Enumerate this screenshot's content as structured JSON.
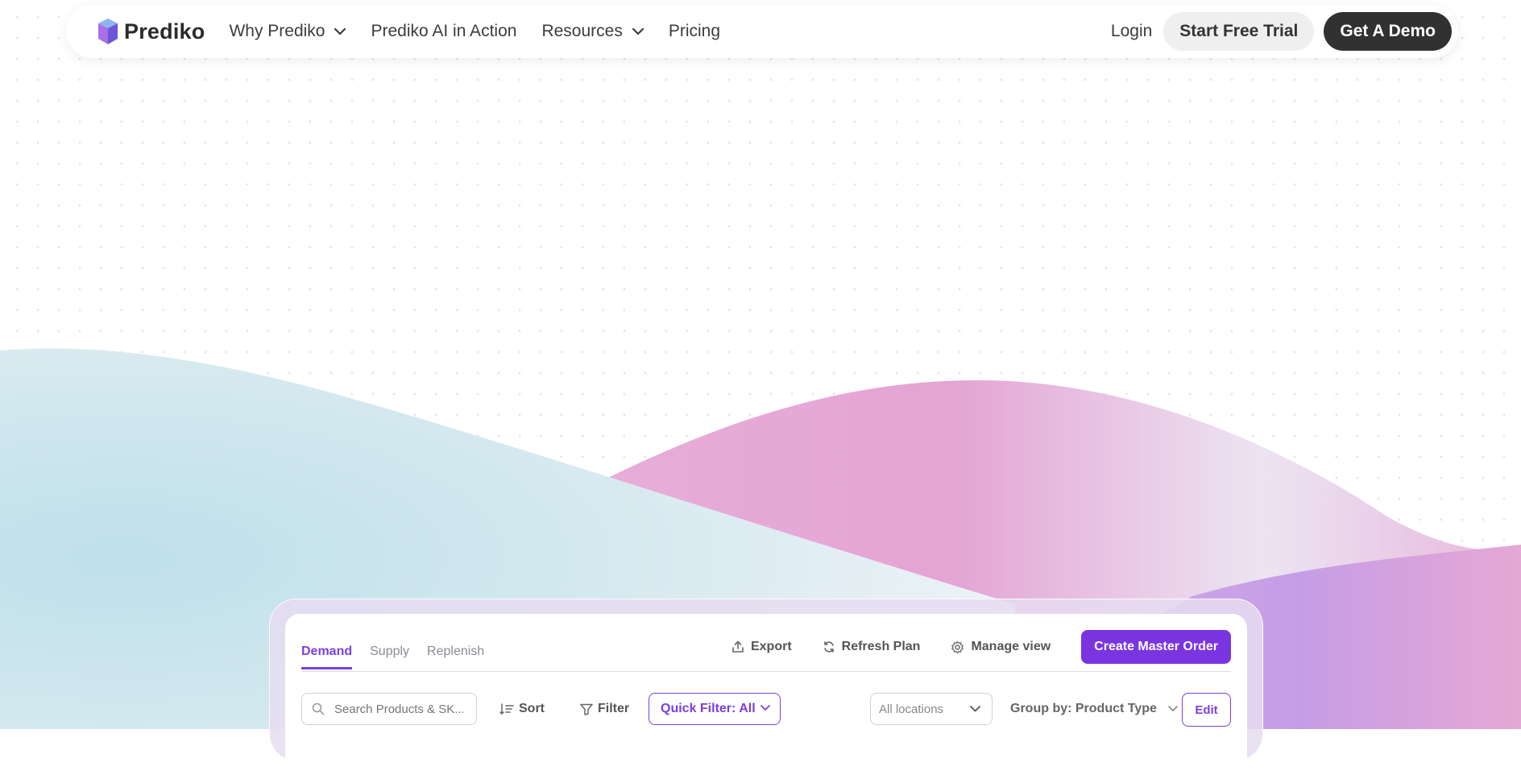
{
  "brand": {
    "name": "Prediko",
    "logo_icon": "cube-logo-icon"
  },
  "nav": {
    "items": [
      {
        "label": "Why Prediko",
        "has_dropdown": true
      },
      {
        "label": "Prediko AI in Action",
        "has_dropdown": false
      },
      {
        "label": "Resources",
        "has_dropdown": true
      },
      {
        "label": "Pricing",
        "has_dropdown": false
      }
    ],
    "login": "Login",
    "trial": "Start Free Trial",
    "demo": "Get A Demo"
  },
  "app": {
    "tabs": [
      {
        "label": "Demand",
        "active": true
      },
      {
        "label": "Supply",
        "active": false
      },
      {
        "label": "Replenish",
        "active": false
      }
    ],
    "actions": {
      "export": "Export",
      "refresh": "Refresh Plan",
      "manage": "Manage view",
      "create": "Create Master Order"
    },
    "toolbar": {
      "search_placeholder": "Search Products & SK...",
      "sort": "Sort",
      "filter": "Filter",
      "quick_filter": "Quick Filter: All",
      "locations": "All locations",
      "group_by": "Group by: Product Type",
      "edit": "Edit"
    }
  },
  "colors": {
    "accent": "#7a35e0",
    "dark_button": "#313131",
    "light_button": "#efefef",
    "wave_blue": "#c5e3ec",
    "wave_pink": "#e7a9d8",
    "wave_purple": "#b78ee6"
  }
}
